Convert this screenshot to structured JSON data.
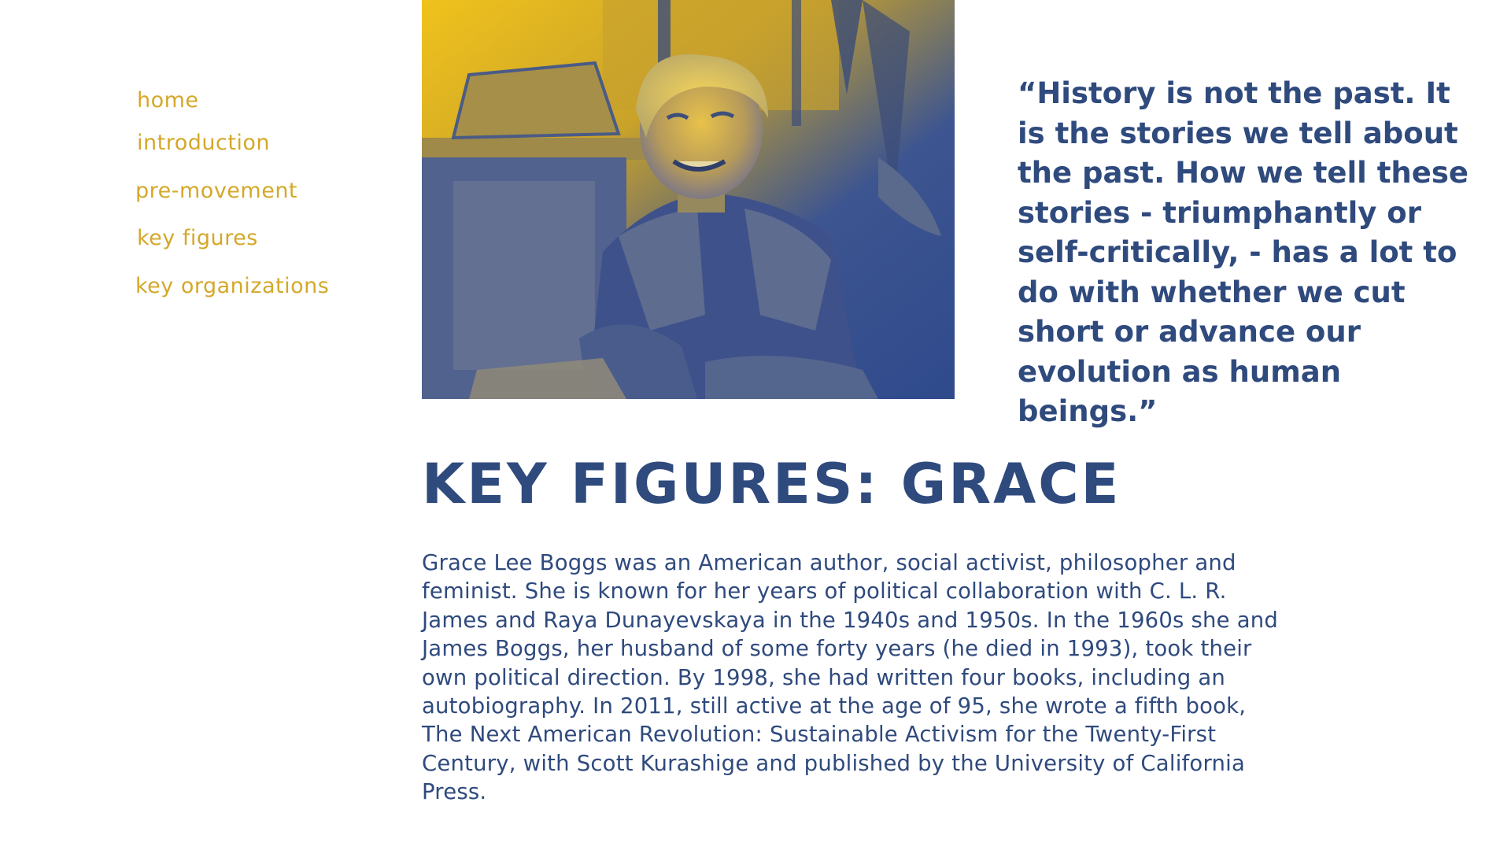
{
  "nav": {
    "items": [
      {
        "label": "home"
      },
      {
        "label": "introduction"
      },
      {
        "label": "pre-movement"
      },
      {
        "label": "key figures"
      },
      {
        "label": "key organizations"
      }
    ]
  },
  "quote": {
    "text": "“History is not the past. It is the stories we tell about the past. How we tell these stories - triumphantly or self-critically, - has a lot to do with whether we cut short or advance our evolution as human beings.”"
  },
  "title": "KEY FIGURES: GRACE",
  "body": "Grace Lee Boggs was an American author, social activist, philosopher and feminist. She is known for her years of political collaboration with C. L. R. James and Raya Dunayevskaya in the 1940s and 1950s. In the 1960s she and James Boggs, her husband of some forty years (he died in 1993), took their own political direction. By 1998, she had written four books, including an autobiography. In 2011, still active at the age of 95, she wrote a fifth book, The Next American Revolution: Sustainable Activism for the Twenty-First Century, with Scott Kurashige and published by the University of California Press.",
  "colors": {
    "accent_gold": "#d4a82a",
    "text_blue": "#2f4a7d",
    "duotone_yellow": "#f0c21c",
    "duotone_blue": "#2f4a8c"
  }
}
